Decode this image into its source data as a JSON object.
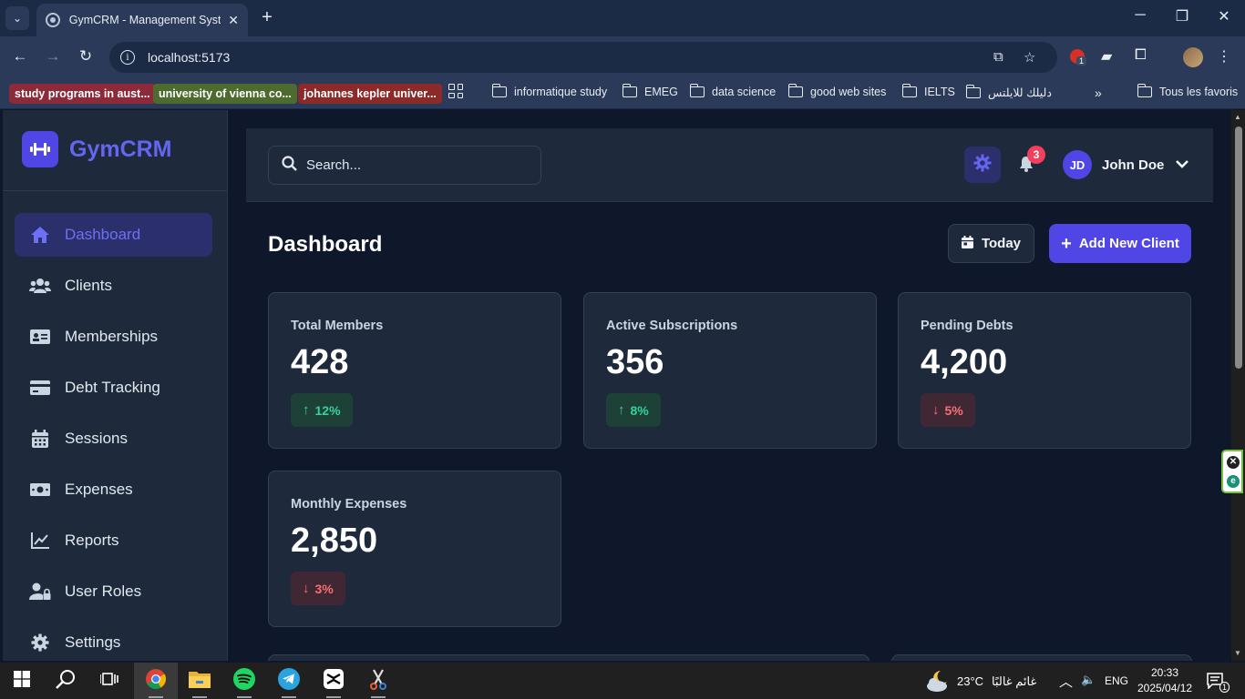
{
  "browser": {
    "tab_title": "GymCRM - Management System",
    "url": "localhost:5173",
    "bookmarks_chips": [
      {
        "label": "study programs in aust...",
        "color": "#8c2a3a"
      },
      {
        "label": "university of vienna co...",
        "color": "#4d6b2f"
      },
      {
        "label": "johannes kepler univer...",
        "color": "#8c2a2a"
      }
    ],
    "bookmark_folders": [
      "informatique study",
      "EMEG",
      "data science",
      "good web sites",
      "IELTS",
      "دليلك للايلتس"
    ],
    "all_bookmarks": "Tous les favoris",
    "extension_badge": "1"
  },
  "app": {
    "brand": "GymCRM",
    "nav": [
      {
        "label": "Dashboard",
        "icon": "home-icon",
        "active": true
      },
      {
        "label": "Clients",
        "icon": "users-icon"
      },
      {
        "label": "Memberships",
        "icon": "id-card-icon"
      },
      {
        "label": "Debt Tracking",
        "icon": "credit-card-icon"
      },
      {
        "label": "Sessions",
        "icon": "calendar-icon"
      },
      {
        "label": "Expenses",
        "icon": "money-icon"
      },
      {
        "label": "Reports",
        "icon": "chart-line-icon"
      },
      {
        "label": "User Roles",
        "icon": "user-lock-icon"
      },
      {
        "label": "Settings",
        "icon": "gear-icon"
      }
    ],
    "search_placeholder": "Search...",
    "notifications_count": "3",
    "user": {
      "initials": "JD",
      "name": "John Doe"
    },
    "page_title": "Dashboard",
    "today_label": "Today",
    "add_client_label": "Add New Client",
    "stats": [
      {
        "label": "Total Members",
        "value": "428",
        "trend": "12%",
        "direction": "up"
      },
      {
        "label": "Active Subscriptions",
        "value": "356",
        "trend": "8%",
        "direction": "up"
      },
      {
        "label": "Pending Debts",
        "value": "4,200",
        "trend": "5%",
        "direction": "down"
      },
      {
        "label": "Monthly Expenses",
        "value": "2,850",
        "trend": "3%",
        "direction": "down"
      }
    ],
    "colors": {
      "accent": "#4f46e5",
      "up": "#34d399",
      "down": "#f87171",
      "bg": "#0f172a",
      "card": "#1e293b"
    }
  },
  "taskbar": {
    "weather_temp": "23°C",
    "weather_text": "غائم غالبًا",
    "lang": "ENG",
    "time": "20:33",
    "date": "2025/04/12",
    "notif_count": "1"
  }
}
